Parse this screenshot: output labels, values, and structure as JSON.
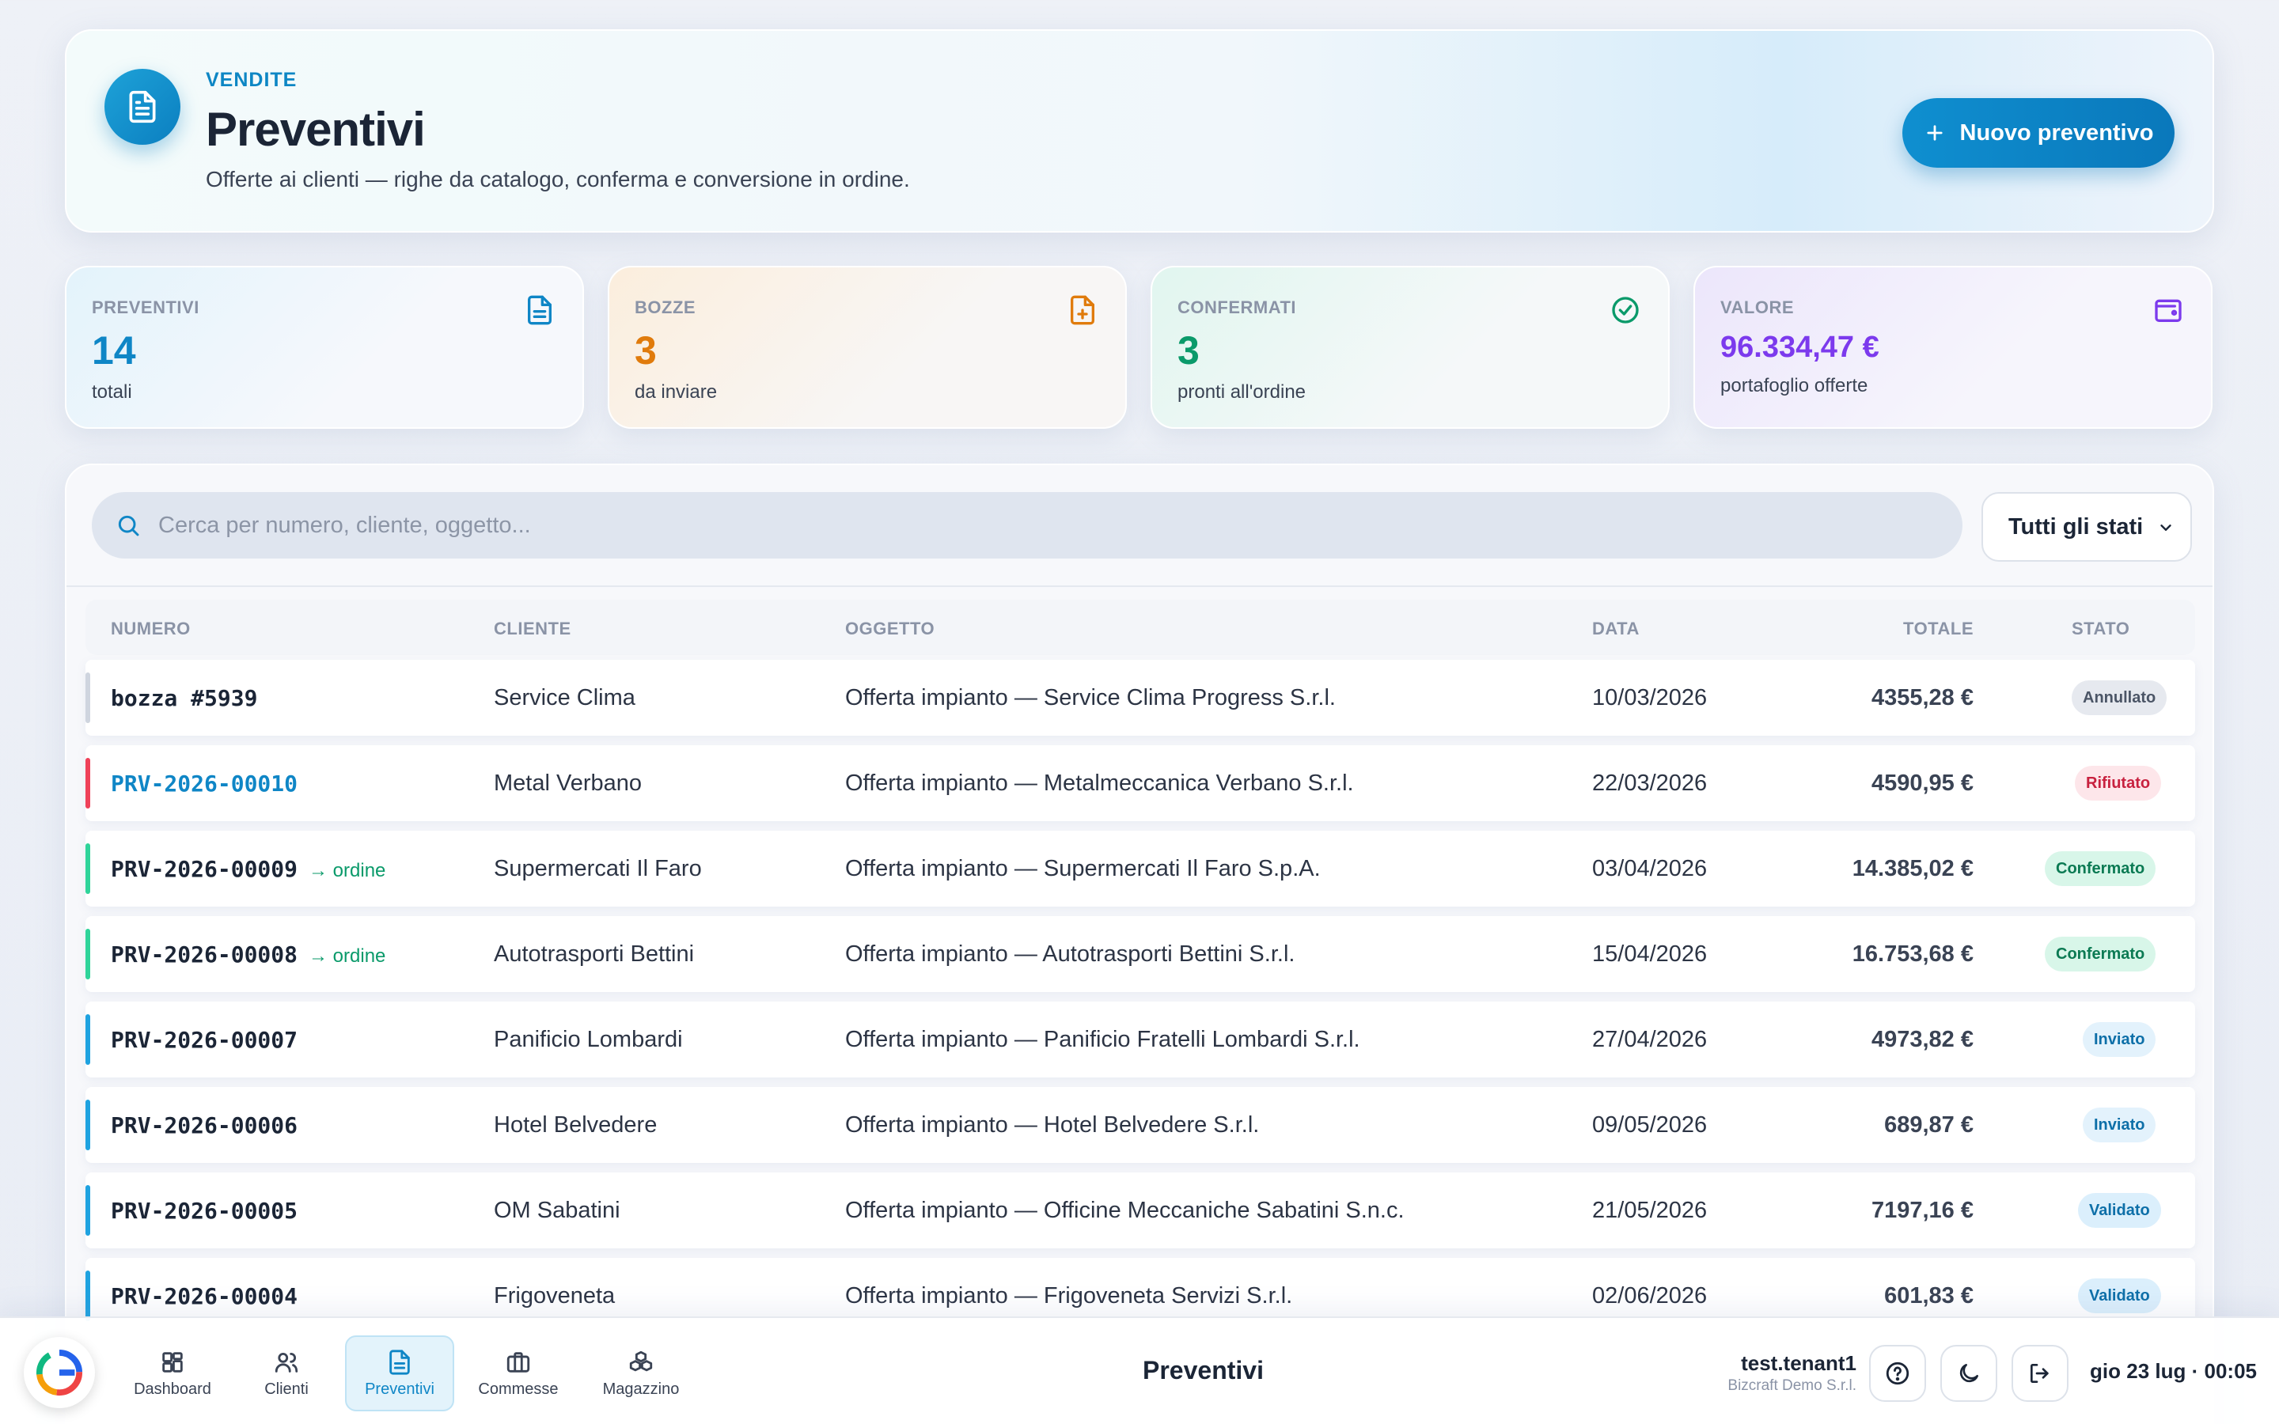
{
  "header": {
    "eyebrow": "VENDITE",
    "title": "Preventivi",
    "subtitle": "Offerte ai clienti — righe da catalogo, conferma e conversione in ordine.",
    "new_button": "Nuovo preventivo",
    "icon": "document-icon"
  },
  "stats": [
    {
      "label": "PREVENTIVI",
      "value": "14",
      "sub": "totali",
      "icon": "document-icon",
      "color": "#0f86c6"
    },
    {
      "label": "BOZZE",
      "value": "3",
      "sub": "da inviare",
      "icon": "file-plus-icon",
      "color": "#e07b0c"
    },
    {
      "label": "CONFERMATI",
      "value": "3",
      "sub": "pronti all'ordine",
      "icon": "check-circle-icon",
      "color": "#0a9a6a"
    },
    {
      "label": "VALORE",
      "value": "96.334,47 €",
      "sub": "portafoglio offerte",
      "icon": "wallet-icon",
      "color": "#7c3aed"
    }
  ],
  "search": {
    "placeholder": "Cerca per numero, cliente, oggetto..."
  },
  "filter": {
    "selected": "Tutti gli stati"
  },
  "table": {
    "headers": {
      "numero": "NUMERO",
      "cliente": "CLIENTE",
      "oggetto": "OGGETTO",
      "data": "DATA",
      "totale": "TOTALE",
      "stato": "STATO"
    },
    "rows": [
      {
        "numero": "bozza #5939",
        "tag": "",
        "cliente": "Service Clima",
        "oggetto": "Offerta impianto — Service Clima Progress S.r.l.",
        "data": "10/03/2026",
        "totale": "4355,28 €",
        "stato": "Annullato",
        "bar": "#cfd5df"
      },
      {
        "numero": "PRV-2026-00010",
        "tag": "",
        "cliente": "Metal Verbano",
        "oggetto": "Offerta impianto — Metalmeccanica Verbano S.r.l.",
        "data": "22/03/2026",
        "totale": "4590,95 €",
        "stato": "Rifiutato",
        "bar": "#ef4159"
      },
      {
        "numero": "PRV-2026-00009",
        "tag": "→ ordine",
        "cliente": "Supermercati Il Faro",
        "oggetto": "Offerta impianto — Supermercati Il Faro S.p.A.",
        "data": "03/04/2026",
        "totale": "14.385,02 €",
        "stato": "Confermato",
        "bar": "#2fd49a"
      },
      {
        "numero": "PRV-2026-00008",
        "tag": "→ ordine",
        "cliente": "Autotrasporti Bettini",
        "oggetto": "Offerta impianto — Autotrasporti Bettini S.r.l.",
        "data": "15/04/2026",
        "totale": "16.753,68 €",
        "stato": "Confermato",
        "bar": "#2fd49a"
      },
      {
        "numero": "PRV-2026-00007",
        "tag": "",
        "cliente": "Panificio Lombardi",
        "oggetto": "Offerta impianto — Panificio Fratelli Lombardi S.r.l.",
        "data": "27/04/2026",
        "totale": "4973,82 €",
        "stato": "Inviato",
        "bar": "#1ea2e0"
      },
      {
        "numero": "PRV-2026-00006",
        "tag": "",
        "cliente": "Hotel Belvedere",
        "oggetto": "Offerta impianto — Hotel Belvedere S.r.l.",
        "data": "09/05/2026",
        "totale": "689,87 €",
        "stato": "Inviato",
        "bar": "#1ea2e0"
      },
      {
        "numero": "PRV-2026-00005",
        "tag": "",
        "cliente": "OM Sabatini",
        "oggetto": "Offerta impianto — Officine Meccaniche Sabatini S.n.c.",
        "data": "21/05/2026",
        "totale": "7197,16 €",
        "stato": "Validato",
        "bar": "#1ea2e0"
      },
      {
        "numero": "PRV-2026-00004",
        "tag": "",
        "cliente": "Frigoveneta",
        "oggetto": "Offerta impianto — Frigoveneta Servizi S.r.l.",
        "data": "02/06/2026",
        "totale": "601,83 €",
        "stato": "Validato",
        "bar": "#1ea2e0"
      }
    ]
  },
  "bottom_nav": {
    "items": [
      {
        "label": "Dashboard",
        "icon": "grid-icon"
      },
      {
        "label": "Clienti",
        "icon": "users-icon"
      },
      {
        "label": "Preventivi",
        "icon": "document-icon"
      },
      {
        "label": "Commesse",
        "icon": "briefcase-icon"
      },
      {
        "label": "Magazzino",
        "icon": "boxes-icon"
      }
    ],
    "current": "Preventivi",
    "user_name": "test.tenant1",
    "org": "Bizcraft Demo S.r.l.",
    "clock": "gio 23 lug · 00:05"
  }
}
